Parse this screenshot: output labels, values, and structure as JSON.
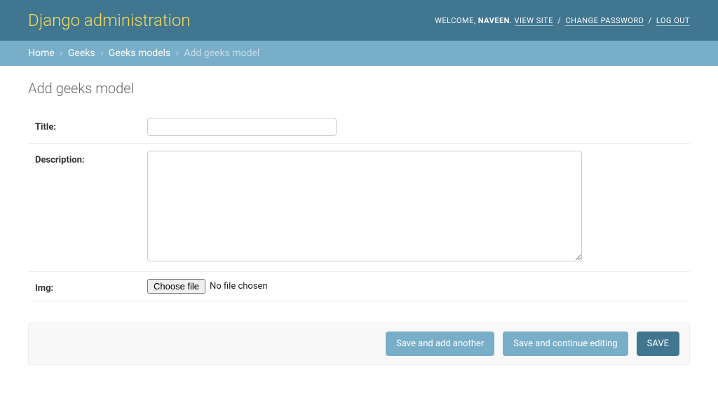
{
  "header": {
    "branding": "Django administration",
    "welcome": "WELCOME,",
    "username": "NAVEEN",
    "view_site": "VIEW SITE",
    "change_password": "CHANGE PASSWORD",
    "log_out": "LOG OUT"
  },
  "breadcrumbs": {
    "home": "Home",
    "app": "Geeks",
    "model": "Geeks models",
    "current": "Add geeks model"
  },
  "page": {
    "title": "Add geeks model"
  },
  "form": {
    "title_label": "Title:",
    "title_value": "",
    "description_label": "Description:",
    "description_value": "",
    "img_label": "Img:",
    "choose_file_label": "Choose file",
    "file_status": "No file chosen"
  },
  "buttons": {
    "save_add_another": "Save and add another",
    "save_continue": "Save and continue editing",
    "save": "SAVE"
  }
}
